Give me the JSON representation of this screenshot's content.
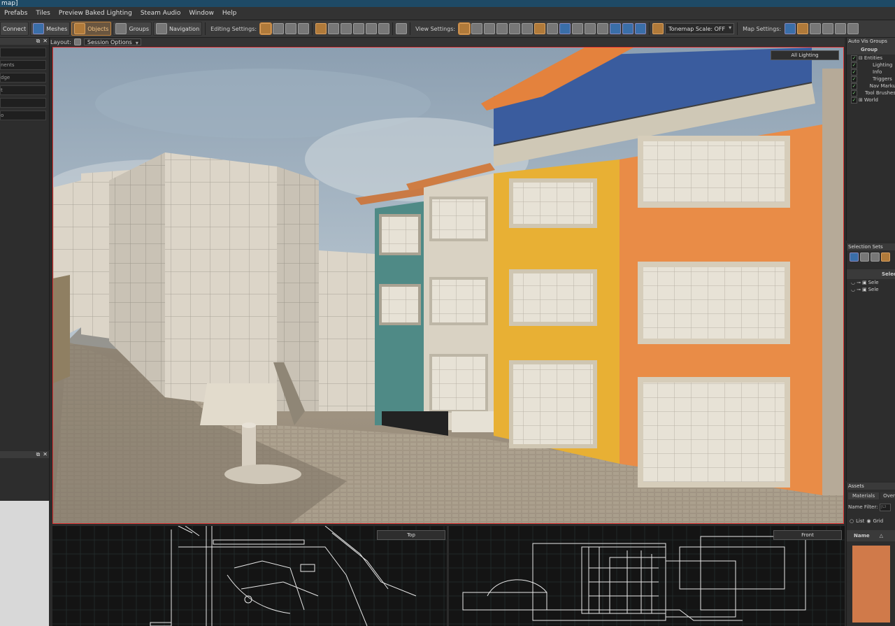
{
  "window": {
    "title": "map]"
  },
  "menu": [
    "Prefabs",
    "Tiles",
    "Preview Baked Lighting",
    "Steam Audio",
    "Window",
    "Help"
  ],
  "toolbar": {
    "connect": "Connect",
    "meshes": "Meshes",
    "objects": "Objects",
    "groups": "Groups",
    "navigation": "Navigation",
    "editing_settings": "Editing Settings:",
    "view_settings": "View Settings:",
    "tonemap": "Tonemap Scale: OFF",
    "map_settings": "Map Settings:"
  },
  "left_panel": {
    "fields": [
      "",
      "nents",
      "dge",
      "t",
      "",
      "o"
    ]
  },
  "layout": {
    "label": "Layout:",
    "session": "Session Options"
  },
  "viewport": {
    "mode": "All Lighting"
  },
  "ortho": {
    "left": "Top",
    "right": "Front"
  },
  "auto_vis": {
    "title": "Auto Vis Groups",
    "column": "Group",
    "items": [
      {
        "label": "Entities",
        "indent": 0
      },
      {
        "label": "Lighting",
        "indent": 2
      },
      {
        "label": "Info",
        "indent": 2
      },
      {
        "label": "Triggers",
        "indent": 2
      },
      {
        "label": "Nav Marku",
        "indent": 2
      },
      {
        "label": "Tool Brushes",
        "indent": 1
      },
      {
        "label": "World",
        "indent": 0
      }
    ]
  },
  "selection_sets": {
    "title": "Selection Sets",
    "column": "Selec",
    "rows": [
      "Sele",
      "Sele"
    ]
  },
  "assets": {
    "title": "Assets",
    "tabs": [
      "Materials",
      "Over"
    ],
    "filter_label": "Name Filter:",
    "filter_placeholder": "(Cl",
    "list": "List",
    "grid": "Grid",
    "name_column": "Name"
  }
}
